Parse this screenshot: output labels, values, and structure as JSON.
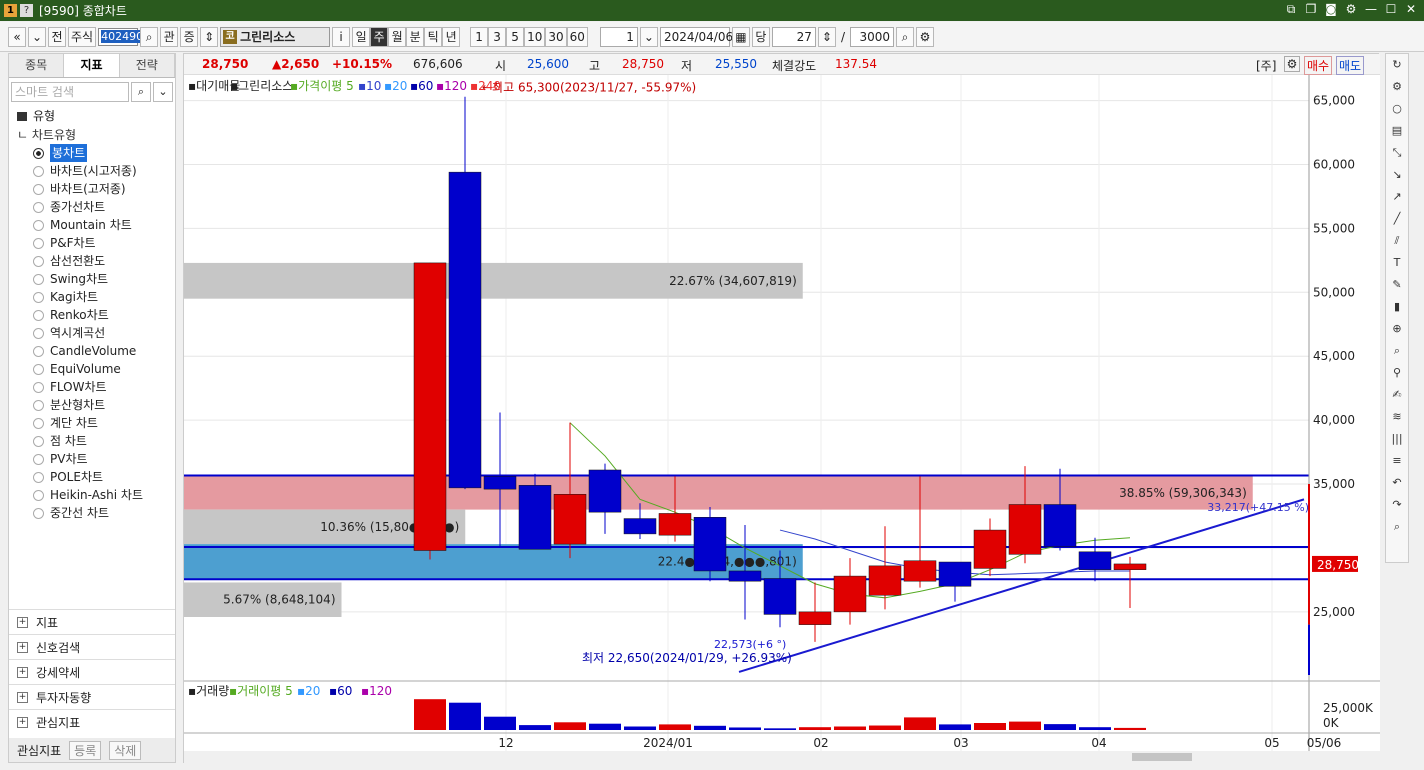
{
  "window": {
    "num": "1",
    "help": "?",
    "title": "[9590] 종합차트"
  },
  "toolbar": {
    "nav_prev": "«",
    "nav_down": "⌄",
    "front": "전",
    "market": "주식",
    "code": "402490",
    "search_icon": "⌕",
    "kwan": "관",
    "jeung": "증",
    "name_badge": "코",
    "name": "그린리소스",
    "info": "i",
    "periods": [
      "일",
      "주",
      "월",
      "분",
      "틱",
      "년"
    ],
    "selected_period": "주",
    "intervals": [
      "1",
      "3",
      "5",
      "10",
      "30",
      "60"
    ],
    "unit_value": "1",
    "date": "2024/04/06",
    "dang": "당",
    "count": "27",
    "slash": "/",
    "total": "3000"
  },
  "left": {
    "tabs": [
      "종목",
      "지표",
      "전략"
    ],
    "active_tab": "지표",
    "search_placeholder": "스마트 검색",
    "section": "유형",
    "tree_head": "차트유형",
    "items": [
      "봉차트",
      "바차트(시고저종)",
      "바차트(고저종)",
      "종가선차트",
      "Mountain 차트",
      "P&F차트",
      "삼선전환도",
      "Swing차트",
      "Kagi차트",
      "Renko차트",
      "역시계곡선",
      "CandleVolume",
      "EquiVolume",
      "FLOW차트",
      "분산형차트",
      "계단 차트",
      "점 차트",
      "PV차트",
      "POLE차트",
      "Heikin-Ashi 차트",
      "중간선 차트"
    ],
    "bottom_sections": [
      "지표",
      "신호검색",
      "강세약세",
      "투자자동향",
      "관심지표"
    ],
    "fav_label": "관심지표",
    "fav_add": "등록",
    "fav_del": "삭제"
  },
  "pricebar": {
    "price": "28,750",
    "change": "▲2,650",
    "rate": "+10.15%",
    "volume": "676,606",
    "open_label": "시",
    "open": "25,600",
    "high_label": "고",
    "high": "28,750",
    "low_label": "저",
    "low": "25,550",
    "strength_label": "체결강도",
    "strength": "137.54",
    "unit": "[주]",
    "buy": "매수",
    "sell": "매도"
  },
  "legend": {
    "upper": {
      "items": [
        "대기매물",
        "그린리소스",
        "가격이평 5",
        "10",
        "20",
        "60",
        "120",
        "240"
      ]
    },
    "lower": {
      "items": [
        "거래량",
        "거래이평 5",
        "20",
        "60",
        "120"
      ]
    }
  },
  "annotations": {
    "high": "←최고 65,300(2023/11/27, -55.97%)",
    "low": "최저 22,650(2024/01/29, +26.93%)",
    "trend_low": "22,573(+6 °)",
    "trend_high": "33,217(+47.15 %)"
  },
  "colors": {
    "up": "#e00000",
    "down": "#0000cc",
    "title_bg": "#2a5a1e"
  },
  "chart_data": {
    "type": "candlestick",
    "title": "그린리소스",
    "ylim": [
      20000,
      68000
    ],
    "yticks": [
      "65,000",
      "60,000",
      "55,000",
      "50,000",
      "45,000",
      "40,000",
      "35,000",
      "25,000"
    ],
    "xticks": [
      "12",
      "2024/01",
      "02",
      "03",
      "04",
      "05",
      "05/06"
    ],
    "candles": [
      {
        "o": 29800,
        "h": 52300,
        "l": 29100,
        "c": 52300,
        "up": true
      },
      {
        "o": 59400,
        "h": 65300,
        "l": 34600,
        "c": 34700,
        "up": false
      },
      {
        "o": 35600,
        "h": 40600,
        "l": 30000,
        "c": 34600,
        "up": false
      },
      {
        "o": 34900,
        "h": 35800,
        "l": 30200,
        "c": 29900,
        "up": false
      },
      {
        "o": 30300,
        "h": 39800,
        "l": 29200,
        "c": 34200,
        "up": true
      },
      {
        "o": 36100,
        "h": 36600,
        "l": 31100,
        "c": 32800,
        "up": false
      },
      {
        "o": 32300,
        "h": 33500,
        "l": 30700,
        "c": 31100,
        "up": false
      },
      {
        "o": 31000,
        "h": 35600,
        "l": 30500,
        "c": 32700,
        "up": true
      },
      {
        "o": 32400,
        "h": 33200,
        "l": 27400,
        "c": 28200,
        "up": false
      },
      {
        "o": 28200,
        "h": 31800,
        "l": 24400,
        "c": 27400,
        "up": false
      },
      {
        "o": 27600,
        "h": 29800,
        "l": 23800,
        "c": 24800,
        "up": false
      },
      {
        "o": 24000,
        "h": 27300,
        "l": 22650,
        "c": 25000,
        "up": true
      },
      {
        "o": 25000,
        "h": 29200,
        "l": 24000,
        "c": 27800,
        "up": true
      },
      {
        "o": 26300,
        "h": 31700,
        "l": 25200,
        "c": 28600,
        "up": true
      },
      {
        "o": 27400,
        "h": 35600,
        "l": 26900,
        "c": 29000,
        "up": true
      },
      {
        "o": 28900,
        "h": 28900,
        "l": 25800,
        "c": 27000,
        "up": false
      },
      {
        "o": 28400,
        "h": 32300,
        "l": 27800,
        "c": 31400,
        "up": true
      },
      {
        "o": 29500,
        "h": 36400,
        "l": 28800,
        "c": 33400,
        "up": true
      },
      {
        "o": 33400,
        "h": 36200,
        "l": 29800,
        "c": 30100,
        "up": false
      },
      {
        "o": 29700,
        "h": 30800,
        "l": 27400,
        "c": 28300,
        "up": false
      },
      {
        "o": 28300,
        "h": 29300,
        "l": 25300,
        "c": 28750,
        "up": true
      }
    ],
    "ma5": [
      null,
      null,
      null,
      null,
      39800,
      37200,
      33800,
      32800,
      31600,
      30000,
      28600,
      27200,
      26400,
      26100,
      26600,
      27200,
      28300,
      29600,
      30200,
      30600,
      30800
    ],
    "ma20": [
      null,
      null,
      null,
      null,
      null,
      null,
      null,
      null,
      null,
      null,
      31400,
      30700,
      29800,
      28900,
      28400,
      28100,
      27900,
      28000,
      28100,
      28200,
      28200
    ],
    "supply": [
      {
        "label": "22.67% (34,607,819)",
        "from": 49500,
        "to": 52300,
        "frac": 0.55,
        "color": "#c6c6c6"
      },
      {
        "label": "38.85% (59,306,343)",
        "from": 33000,
        "to": 35600,
        "frac": 0.95,
        "color": "#e59aa0"
      },
      {
        "label": "10.36% (15,80●,●●●)",
        "from": 30300,
        "to": 33000,
        "frac": 0.25,
        "color": "#c6c6c6"
      },
      {
        "label": "22.4●% (34,●●●,801)",
        "from": 27600,
        "to": 30300,
        "frac": 0.55,
        "color": "#4d9fd0"
      },
      {
        "label": "5.67% (8,648,104)",
        "from": 24600,
        "to": 27300,
        "frac": 0.14,
        "color": "#c6c6c6"
      }
    ],
    "hlines": [
      {
        "value": 35667,
        "label": "35,667"
      },
      {
        "value": 30077,
        "label": "30,077"
      },
      {
        "value": 27551,
        "label": "27,551"
      }
    ],
    "current": {
      "value": 28750,
      "label": "28,750"
    },
    "volume": {
      "ymax": 25000,
      "ytick_labels": [
        "25,000K",
        "0K"
      ],
      "values": [
        22000,
        19500,
        9500,
        3500,
        5500,
        4500,
        2500,
        4000,
        3000,
        1800,
        1200,
        2000,
        2500,
        3200,
        9000,
        4000,
        5000,
        6000,
        4200,
        2000,
        1500
      ]
    }
  }
}
